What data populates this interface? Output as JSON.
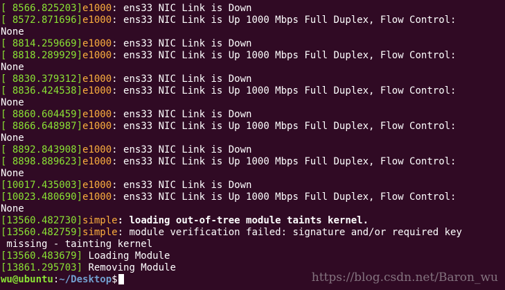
{
  "terminal": {
    "lines": [
      {
        "ts": "[ 8566.825203]",
        "mod": "e1000",
        "sep": ":",
        "msg": " ens33 NIC Link is Down"
      },
      {
        "ts": "[ 8572.871696]",
        "mod": "e1000",
        "sep": ":",
        "msg": " ens33 NIC Link is Up 1000 Mbps Full Duplex, Flow Control:"
      },
      {
        "msg": "None"
      },
      {
        "ts": "[ 8814.259669]",
        "mod": "e1000",
        "sep": ":",
        "msg": " ens33 NIC Link is Down"
      },
      {
        "ts": "[ 8818.289929]",
        "mod": "e1000",
        "sep": ":",
        "msg": " ens33 NIC Link is Up 1000 Mbps Full Duplex, Flow Control:"
      },
      {
        "msg": "None"
      },
      {
        "ts": "[ 8830.379312]",
        "mod": "e1000",
        "sep": ":",
        "msg": " ens33 NIC Link is Down"
      },
      {
        "ts": "[ 8836.424538]",
        "mod": "e1000",
        "sep": ":",
        "msg": " ens33 NIC Link is Up 1000 Mbps Full Duplex, Flow Control:"
      },
      {
        "msg": "None"
      },
      {
        "ts": "[ 8860.604459]",
        "mod": "e1000",
        "sep": ":",
        "msg": " ens33 NIC Link is Down"
      },
      {
        "ts": "[ 8866.648987]",
        "mod": "e1000",
        "sep": ":",
        "msg": " ens33 NIC Link is Up 1000 Mbps Full Duplex, Flow Control:"
      },
      {
        "msg": "None"
      },
      {
        "ts": "[ 8892.843908]",
        "mod": "e1000",
        "sep": ":",
        "msg": " ens33 NIC Link is Down"
      },
      {
        "ts": "[ 8898.889623]",
        "mod": "e1000",
        "sep": ":",
        "msg": " ens33 NIC Link is Up 1000 Mbps Full Duplex, Flow Control:"
      },
      {
        "msg": "None"
      },
      {
        "ts": "[10017.435003]",
        "mod": "e1000",
        "sep": ":",
        "msg": " ens33 NIC Link is Down"
      },
      {
        "ts": "[10023.480690]",
        "mod": "e1000",
        "sep": ":",
        "msg": " ens33 NIC Link is Up 1000 Mbps Full Duplex, Flow Control:"
      },
      {
        "msg": "None"
      },
      {
        "ts": "[13560.482730]",
        "mod": "simple",
        "sep": ":",
        "msg": " loading out-of-tree module taints kernel.",
        "bold": true
      },
      {
        "ts": "[13560.482759]",
        "mod": "simple",
        "sep": ":",
        "msg": " module verification failed: signature and/or required key"
      },
      {
        "msg": " missing - tainting kernel"
      },
      {
        "ts": "[13560.483679]",
        "msg": " Loading Module"
      },
      {
        "ts": "[13861.295703]",
        "msg": " Removing Module"
      }
    ],
    "prompt": {
      "user_host": "wu@ubuntu",
      "colon": ":",
      "path": "~/Desktop",
      "symbol": "$"
    }
  },
  "watermark": "https://blog.csdn.net/Baron_wu",
  "colors": {
    "background": "#300a24",
    "timestamp": "#8ae234",
    "module": "#fcaf3e",
    "text": "#ffffff",
    "path": "#729fcf"
  }
}
